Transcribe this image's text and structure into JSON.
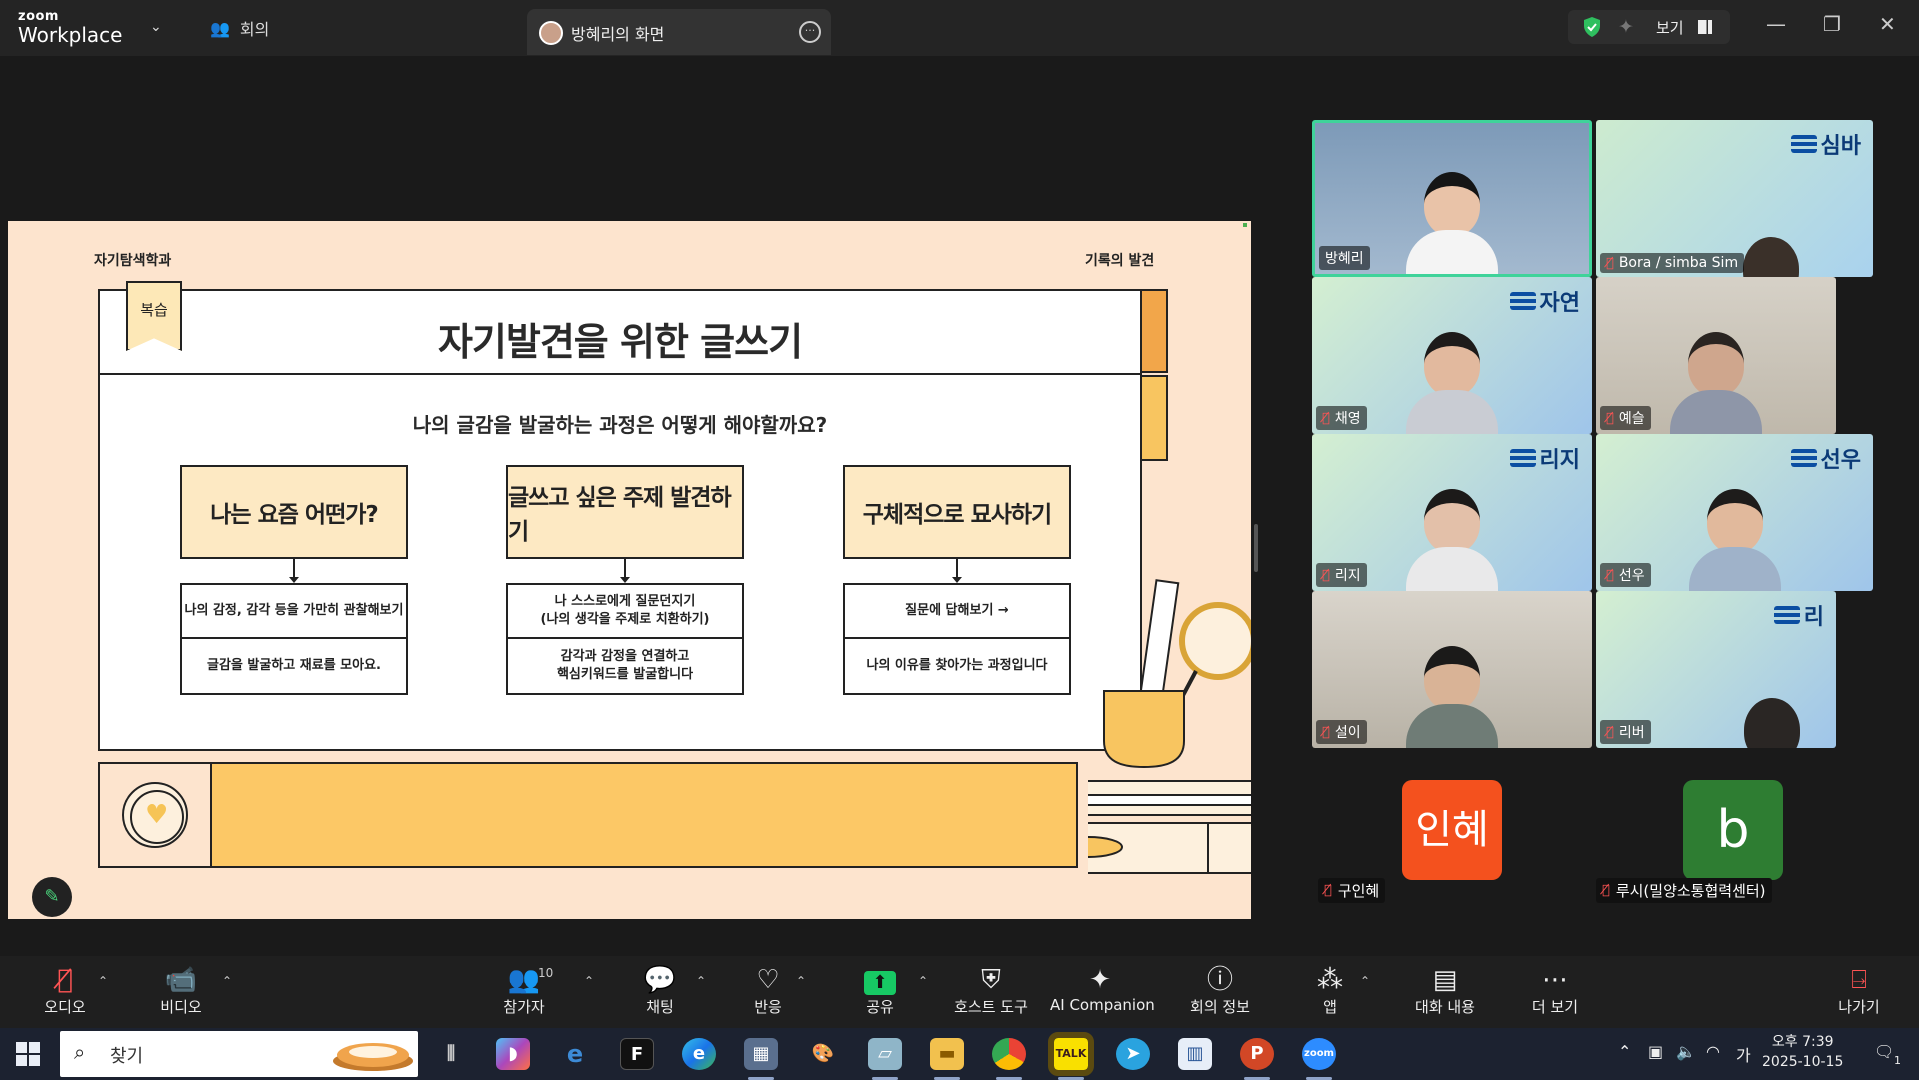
{
  "titlebar": {
    "brand_top": "zoom",
    "brand_bottom": "Workplace",
    "meeting_tab": "회의",
    "share_tab": "방혜리의 화면",
    "view_label": "보기"
  },
  "slide": {
    "dept": "자기탐색학과",
    "record": "기록의 발견",
    "badge": "복습",
    "title": "자기발견을 위한 글쓰기",
    "question": "나의 글감을 발굴하는 과정은 어떻게 해야할까요?",
    "columns": [
      {
        "head": "나는 요즘 어떤가?",
        "row1": "나의 감정, 감각 등을 가만히 관찰해보기",
        "row2": "글감을 발굴하고 재료를 모아요."
      },
      {
        "head": "글쓰고 싶은 주제 발견하기",
        "row1": "나 스스로에게 질문던지기\n(나의 생각을 주제로 치환하기)",
        "row2": "감각과 감정을 연결하고\n핵심키워드를 발굴합니다"
      },
      {
        "head": "구체적으로 묘사하기",
        "row1": "질문에 답해보기 →",
        "row2": "나의 이유를 찾아가는 과정입니다"
      }
    ]
  },
  "gallery": {
    "tiles": [
      {
        "name": "방혜리",
        "watermark": ""
      },
      {
        "name": "Bora / simba Sim",
        "watermark": "심바"
      },
      {
        "name": "채영",
        "watermark": "자연"
      },
      {
        "name": "예슬",
        "watermark": ""
      },
      {
        "name": "리지",
        "watermark": "리지"
      },
      {
        "name": "선우",
        "watermark": "선우"
      },
      {
        "name": "설이",
        "watermark": ""
      },
      {
        "name": "리버",
        "watermark": "리"
      }
    ],
    "avatars": [
      {
        "initials": "인혜",
        "name": "구인혜",
        "color": "#f4511e"
      },
      {
        "initials": "b",
        "name": "루시(밀양소통협력센터)",
        "color": "#2e7d32"
      }
    ]
  },
  "toolbar": {
    "audio": "오디오",
    "video": "비디오",
    "participants": "참가자",
    "participants_count": "10",
    "chat": "채팅",
    "react": "반응",
    "share": "공유",
    "host_tools": "호스트 도구",
    "ai": "AI Companion",
    "info": "회의 정보",
    "apps": "앱",
    "transcript": "대화 내용",
    "more": "더 보기",
    "leave": "나가기"
  },
  "taskbar": {
    "search_placeholder": "찾기",
    "ime": "가",
    "time": "오후 7:39",
    "date": "2025-10-15",
    "notif_count": "1"
  },
  "colors": {
    "accent_green": "#3fd39a",
    "share_green": "#17c964",
    "mute_red": "#ff5454"
  }
}
